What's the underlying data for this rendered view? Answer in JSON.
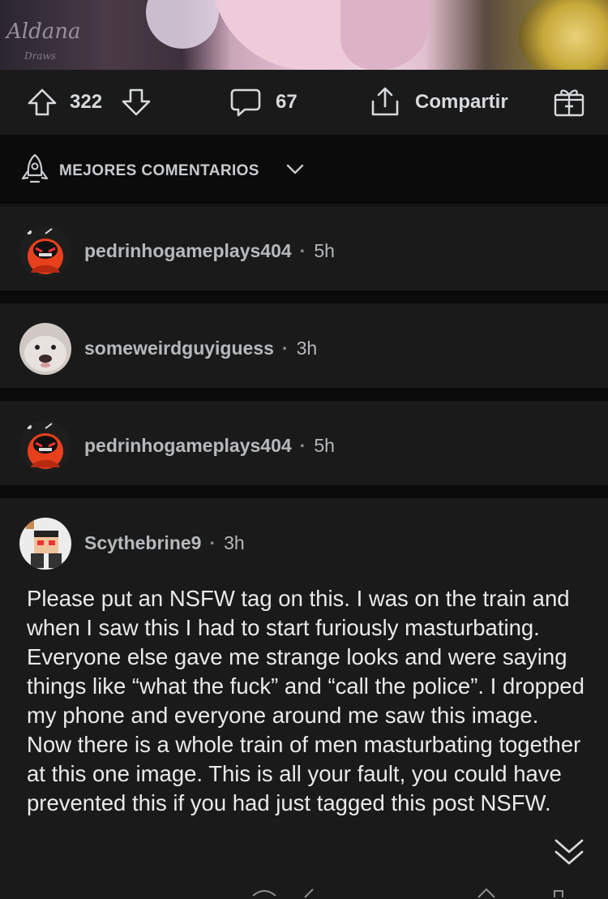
{
  "hero": {
    "signature": "Aldana",
    "signature_sub": "Draws"
  },
  "actions": {
    "upvotes": "322",
    "comments": "67",
    "share_label": "Compartir",
    "icons": [
      "upvote-icon",
      "downvote-icon",
      "comment-icon",
      "share-icon",
      "gift-icon"
    ]
  },
  "sort": {
    "label": "MEJORES COMENTARIOS",
    "icon": "rocket-icon"
  },
  "comments": [
    {
      "user": "pedrinhogameplays404",
      "time": "5h"
    },
    {
      "user": "someweirdguyiguess",
      "time": "3h"
    },
    {
      "user": "pedrinhogameplays404",
      "time": "5h"
    },
    {
      "user": "Scythebrine9",
      "time": "3h",
      "body": "Please put an NSFW tag on this. I was on the train and when I saw this I had to start furiously masturbating. Everyone else gave me strange looks and were saying things like “what the fuck” and “call the police”. I dropped my phone and everyone around me saw this image. Now there is a whole train of men masturbating together at this one image. This is all your fault, you could have prevented this if you had just tagged this post NSFW."
    }
  ],
  "colors": {
    "background": "#0b0b0c",
    "card": "#1a1a1b",
    "text": "#d7dadc",
    "avatar_red": "#e8401c"
  }
}
